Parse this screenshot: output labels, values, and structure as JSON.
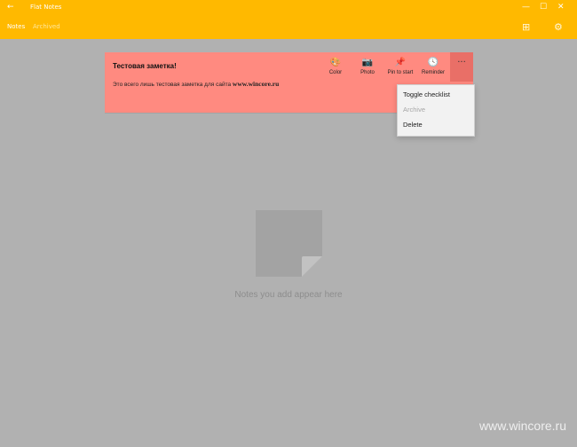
{
  "window": {
    "title": "Flat Notes",
    "controls": [
      "—",
      "☐",
      "✕"
    ]
  },
  "nav": {
    "tabs": [
      {
        "label": "Notes"
      },
      {
        "label": "Archived"
      }
    ],
    "icons": [
      "add-icon",
      "settings-icon"
    ]
  },
  "note": {
    "title": "Тестовая заметка!",
    "body_prefix": "Это всего лишь тестовая заметка для сайта",
    "body_link": "www.wincore.ru",
    "actions": [
      {
        "label": "Color",
        "icon": "palette-icon"
      },
      {
        "label": "Photo",
        "icon": "camera-icon"
      },
      {
        "label": "Pin to start",
        "icon": "pin-icon"
      },
      {
        "label": "Reminder",
        "icon": "clock-icon"
      }
    ],
    "more_label": "···"
  },
  "menu": {
    "items": [
      {
        "label": "Toggle checklist",
        "disabled": false
      },
      {
        "label": "Archive",
        "disabled": true
      },
      {
        "label": "Delete",
        "disabled": false
      }
    ]
  },
  "empty_state": {
    "text": "Notes you add appear here"
  },
  "watermark": {
    "text": "www.wincore.ru"
  },
  "colors": {
    "accent": "#ffb900",
    "note": "#ff8a80",
    "background": "#b1b1b1"
  }
}
